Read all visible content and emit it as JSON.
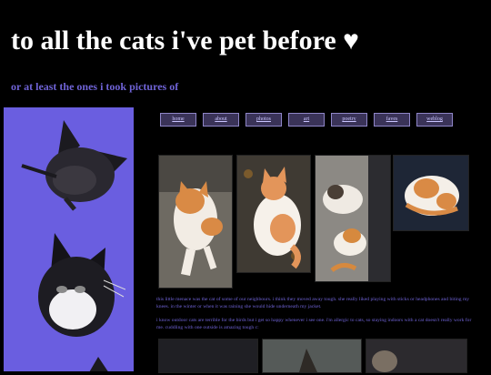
{
  "header": {
    "title": "to all the cats i've pet before ♥",
    "subtitle": "or at least the ones i took pictures of"
  },
  "nav": {
    "items": [
      {
        "label": "home"
      },
      {
        "label": "about"
      },
      {
        "label": "photos"
      },
      {
        "label": "art"
      },
      {
        "label": "poetry"
      },
      {
        "label": "faves"
      },
      {
        "label": "weblog"
      }
    ]
  },
  "captions": [
    "this little menace was the cat of some of our neighbours. i think they moved away tough. she really liked playing with sticks or headphones and biting my knees. in the winter or when it was raining she would hide underneath my jacket.",
    "i know outdoor cats are terrible for the birds but i get so happy whenever i see one. i'm allergic to cats, so staying indoors with a cat doesn't really work for me. cuddling with one outside is amazing tough c:"
  ],
  "colors": {
    "background": "#000000",
    "sidebar": "#6a5ee0",
    "accent_text": "#6f63d6",
    "nav_button": "#3a3358"
  },
  "icons": {
    "heart": "heart-icon"
  }
}
